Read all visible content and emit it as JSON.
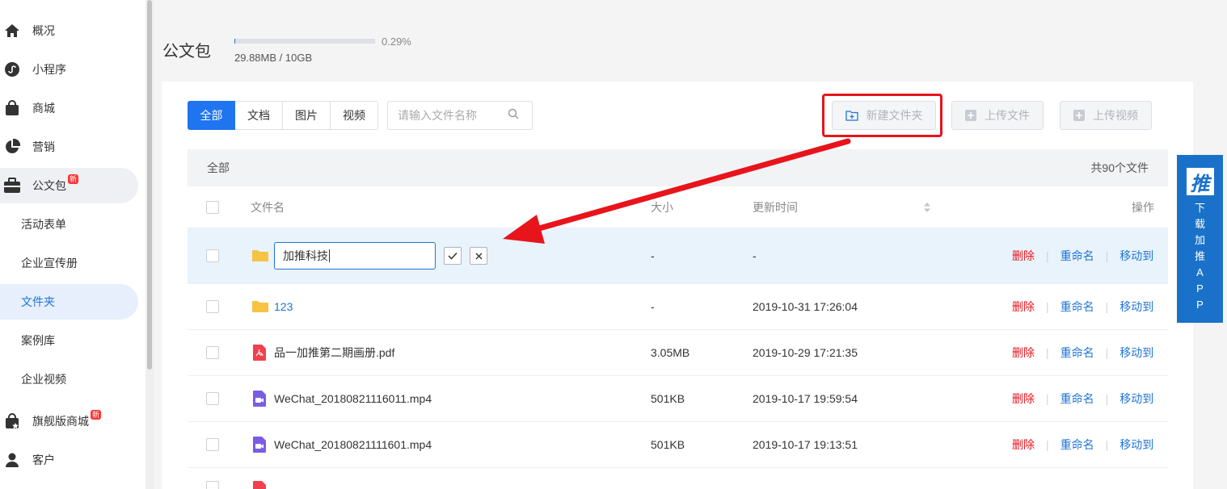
{
  "sidebar": {
    "items": [
      {
        "label": "概况",
        "icon": "home-icon"
      },
      {
        "label": "小程序",
        "icon": "mini-program-icon"
      },
      {
        "label": "商城",
        "icon": "shopping-bag-icon"
      },
      {
        "label": "营销",
        "icon": "pie-chart-icon"
      },
      {
        "label": "公文包",
        "icon": "briefcase-icon",
        "badge": "新"
      },
      {
        "label": "旗舰版商城",
        "icon": "premium-bag-icon",
        "badge": "新"
      },
      {
        "label": "客户",
        "icon": "user-icon"
      }
    ],
    "sub_items": [
      "活动表单",
      "企业宣传册",
      "文件夹",
      "案例库",
      "企业视频"
    ]
  },
  "header": {
    "title": "公文包",
    "usage_percent": "0.29%",
    "usage_fraction": 0.0029,
    "usage_text": "29.88MB / 10GB"
  },
  "toolbar": {
    "tabs": [
      "全部",
      "文档",
      "图片",
      "视频"
    ],
    "search_placeholder": "请输入文件名称",
    "new_folder_label": "新建文件夹",
    "upload_file_label": "上传文件",
    "upload_video_label": "上传视频"
  },
  "list": {
    "crumb": "全部",
    "total": "共90个文件",
    "columns": {
      "name": "文件名",
      "size": "大小",
      "updated": "更新时间",
      "ops": "操作"
    },
    "editing_row": {
      "input_value": "加推科技",
      "size": "-",
      "updated": "-"
    },
    "rows": [
      {
        "name": "123",
        "type": "folder",
        "size": "-",
        "updated": "2019-10-31 17:26:04"
      },
      {
        "name": "品一加推第二期画册.pdf",
        "type": "pdf",
        "size": "3.05MB",
        "updated": "2019-10-29 17:21:35"
      },
      {
        "name": "WeChat_20180821116011.mp4",
        "type": "video",
        "size": "501KB",
        "updated": "2019-10-17 19:59:54"
      },
      {
        "name": "WeChat_20180821111601.mp4",
        "type": "video",
        "size": "501KB",
        "updated": "2019-10-17 19:13:51"
      }
    ],
    "actions": {
      "delete": "删除",
      "rename": "重命名",
      "move": "移动到"
    }
  },
  "promo": {
    "logo": "推",
    "text": "下载加推APP"
  },
  "colors": {
    "primary": "#1f74f0",
    "danger": "#e8141c",
    "highlight": "#e8141c",
    "promo": "#1a71c9"
  }
}
